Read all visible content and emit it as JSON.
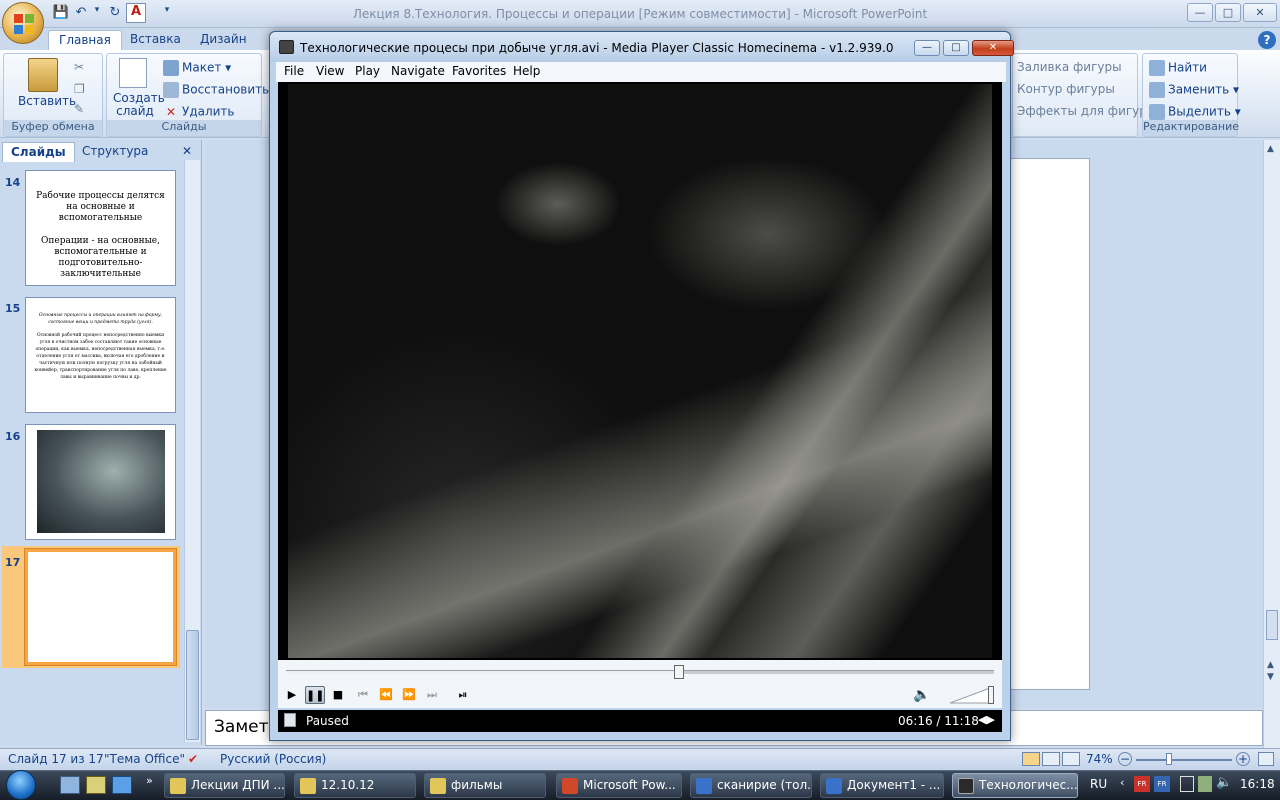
{
  "powerpoint": {
    "title": "Лекция 8.Технология. Процессы и операции [Режим совместимости] - Microsoft PowerPoint",
    "tabs": [
      "Главная",
      "Вставка",
      "Дизайн"
    ],
    "clipboard": {
      "paste": "Вставить",
      "label": "Буфер обмена"
    },
    "slides_group": {
      "create": "Создать слайд",
      "layout": "Макет",
      "restore": "Восстановить",
      "delete": "Удалить",
      "label": "Слайды"
    },
    "drawing": {
      "fill": "Заливка фигуры",
      "outline": "Контур фигуры",
      "effects": "Эффекты для фигур"
    },
    "editing": {
      "find": "Найти",
      "replace": "Заменить",
      "select": "Выделить",
      "label": "Редактирование"
    },
    "pane_tabs": {
      "slides": "Слайды",
      "outline": "Структура"
    },
    "slides": [
      {
        "number": "14",
        "line1": "Рабочие процессы делятся на основные и вспомогательные",
        "line2": "Операции - на основные, вспомогательные и подготовительно-заключительные"
      },
      {
        "number": "15",
        "line1": "Основные процессы и операции влияют на форму, состояние вещи и предмета труда (угля).",
        "line2": "Основной рабочий процесс непосредственно выемки угля в очистном забое составляют такие основные операции, как выемка, непосредственная выемка, т.е. отделение угля от массива, включая его дробление и частичную или полную погрузку угля на забойный конвейер, транспортирование угля по лаве, крепление лавы и выравнивание почвы и др."
      },
      {
        "number": "16"
      },
      {
        "number": "17"
      }
    ],
    "notes": "Заметк",
    "status": {
      "slide": "Слайд 17 из 17",
      "theme": "\"Тема Office\"",
      "language": "Русский (Россия)",
      "zoom": "74%"
    }
  },
  "mpc": {
    "title": "Технологические процесы при добыче угля.avi - Media Player Classic Homecinema - v1.2.939.0",
    "menu": [
      "File",
      "View",
      "Play",
      "Navigate",
      "Favorites",
      "Help"
    ],
    "state": "Paused",
    "time": "06:16 / 11:18",
    "progress": 0.555,
    "volume": 1.0
  },
  "taskbar": {
    "items": [
      {
        "label": "Лекции ДПИ ..."
      },
      {
        "label": "12.10.12"
      },
      {
        "label": "фильмы"
      },
      {
        "label": "Microsoft Pow..."
      },
      {
        "label": "сканирие (тол..."
      },
      {
        "label": "Документ1 - ..."
      },
      {
        "label": "Технологичес..."
      }
    ],
    "lang": "RU",
    "clock": "16:18"
  }
}
